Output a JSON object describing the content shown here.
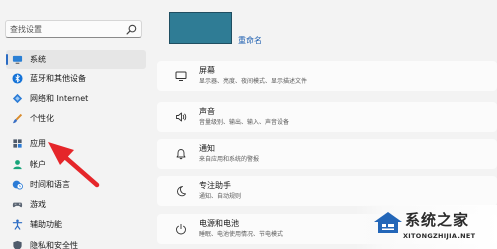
{
  "search": {
    "placeholder": "查找设置"
  },
  "sidebar": {
    "items": [
      {
        "label": "系统",
        "icon": "system-monitor-icon",
        "active": true
      },
      {
        "label": "蓝牙和其他设备",
        "icon": "bluetooth-icon"
      },
      {
        "label": "网络和 Internet",
        "icon": "network-icon"
      },
      {
        "label": "个性化",
        "icon": "paintbrush-icon"
      },
      {
        "label": "应用",
        "icon": "apps-icon"
      },
      {
        "label": "帐户",
        "icon": "account-icon"
      },
      {
        "label": "时间和语言",
        "icon": "globe-clock-icon"
      },
      {
        "label": "游戏",
        "icon": "gamepad-icon"
      },
      {
        "label": "辅助功能",
        "icon": "accessibility-icon"
      },
      {
        "label": "隐私和安全性",
        "icon": "shield-icon"
      }
    ]
  },
  "main": {
    "rename_label": "重命名",
    "cards": [
      {
        "title": "屏幕",
        "subtitle": "显示器、亮度、夜间模式、显示描述文件",
        "icon": "display-icon"
      },
      {
        "title": "声音",
        "subtitle": "音量级别、输出、输入、声音设备",
        "icon": "speaker-icon"
      },
      {
        "title": "通知",
        "subtitle": "来自应用和系统的警报",
        "icon": "bell-icon"
      },
      {
        "title": "专注助手",
        "subtitle": "通知、自动规则",
        "icon": "moon-icon"
      },
      {
        "title": "电源和电池",
        "subtitle": "睡眠、电池使用情况、节电模式",
        "icon": "power-icon"
      }
    ]
  },
  "watermark": {
    "title": "系统之家",
    "url": "XITONGZHIJIA.NET"
  },
  "colors": {
    "accent": "#2b6cc4",
    "arrow": "#e5262a",
    "profile": "#2f7c95"
  }
}
